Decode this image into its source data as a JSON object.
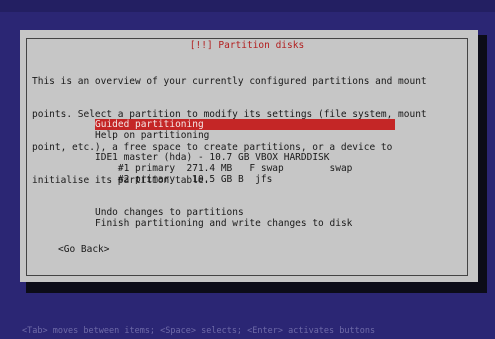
{
  "dialog": {
    "title": "[!!] Partition disks",
    "intro_lines": [
      "This is an overview of your currently configured partitions and mount",
      "points. Select a partition to modify its settings (file system, mount",
      "point, etc.), a free space to create partitions, or a device to",
      "initialise its partition table."
    ],
    "menu": {
      "guided": "Guided partitioning",
      "help": "Help on partitioning",
      "disk": "IDE1 master (hda) - 10.7 GB VBOX HARDDISK",
      "partition1": "    #1 primary  271.4 MB   F swap        swap",
      "partition2": "    #2 primary   10.5 GB B  jfs",
      "undo": "Undo changes to partitions",
      "finish": "Finish partitioning and write changes to disk"
    },
    "go_back": "<Go Back>"
  },
  "status_bar": "<Tab> moves between items; <Space> selects; <Enter> activates buttons",
  "colors": {
    "background": "#2b2674",
    "dialog": "#c6c6c6",
    "highlight": "#c42626",
    "title": "#b21e1e"
  }
}
